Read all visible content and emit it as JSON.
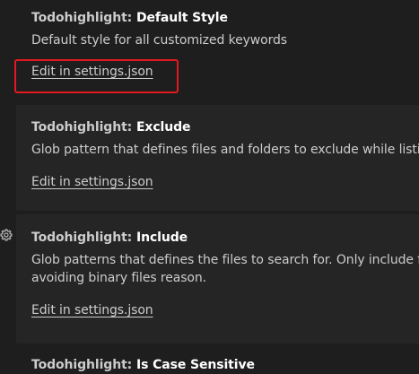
{
  "settings": [
    {
      "category": "Todohighlight: ",
      "label": "Default Style",
      "description": "Default style for all customized keywords",
      "link": "Edit in settings.json"
    },
    {
      "category": "Todohighlight: ",
      "label": "Exclude",
      "description": "Glob pattern that defines files and folders to exclude while listi",
      "link": "Edit in settings.json"
    },
    {
      "category": "Todohighlight: ",
      "label": "Include",
      "description_line1": "Glob patterns that defines the files to search for. Only include f",
      "description_line2": "avoiding binary files reason.",
      "link": "Edit in settings.json"
    },
    {
      "category": "Todohighlight: ",
      "label": "Is Case Sensitive"
    }
  ],
  "colors": {
    "background": "#1e1e1e",
    "focused_row": "#252526",
    "highlight_box": "#e3191f"
  },
  "icons": {
    "gear": "gear-icon"
  }
}
